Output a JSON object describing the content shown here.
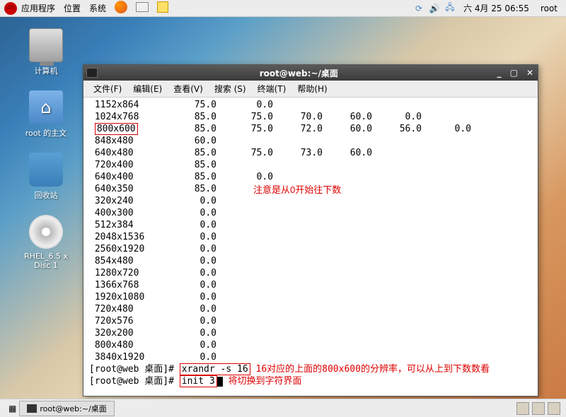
{
  "panel": {
    "apps": "应用程序",
    "places": "位置",
    "system": "系统",
    "clock": "六 4月 25 06:55",
    "user": "root"
  },
  "desktop": {
    "computer": "计算机",
    "home": "root 的主文",
    "trash": "回收站",
    "disc": "RHEL_6.5 x\nDisc 1"
  },
  "window": {
    "title": "root@web:~/桌面",
    "menu": {
      "file": "文件(F)",
      "edit": "编辑(E)",
      "view": "查看(V)",
      "search": "搜索 (S)",
      "terminal": "终端(T)",
      "help": "帮助(H)"
    }
  },
  "xrandr_rows": [
    {
      "res": "1152x864",
      "cols": [
        "75.0",
        "0.0",
        "",
        "",
        "",
        ""
      ]
    },
    {
      "res": "1024x768",
      "cols": [
        "85.0",
        "75.0",
        "70.0",
        "60.0",
        "0.0",
        ""
      ]
    },
    {
      "res": "800x600",
      "cols": [
        "85.0",
        "75.0",
        "72.0",
        "60.0",
        "56.0",
        "0.0"
      ],
      "box": true
    },
    {
      "res": "848x480",
      "cols": [
        "60.0",
        "",
        "",
        "",
        "",
        ""
      ]
    },
    {
      "res": "640x480",
      "cols": [
        "85.0",
        "75.0",
        "73.0",
        "60.0",
        "",
        ""
      ]
    },
    {
      "res": "720x400",
      "cols": [
        "85.0",
        "",
        "",
        "",
        "",
        ""
      ]
    },
    {
      "res": "640x400",
      "cols": [
        "85.0",
        "0.0",
        "",
        "",
        "",
        ""
      ]
    },
    {
      "res": "640x350",
      "cols": [
        "85.0",
        "",
        "",
        "",
        "",
        ""
      ]
    },
    {
      "res": "320x240",
      "cols": [
        "0.0",
        "",
        "",
        "",
        "",
        ""
      ]
    },
    {
      "res": "400x300",
      "cols": [
        "0.0",
        "",
        "",
        "",
        "",
        ""
      ]
    },
    {
      "res": "512x384",
      "cols": [
        "0.0",
        "",
        "",
        "",
        "",
        ""
      ]
    },
    {
      "res": "2048x1536",
      "cols": [
        "0.0",
        "",
        "",
        "",
        "",
        ""
      ]
    },
    {
      "res": "2560x1920",
      "cols": [
        "0.0",
        "",
        "",
        "",
        "",
        ""
      ]
    },
    {
      "res": "854x480",
      "cols": [
        "0.0",
        "",
        "",
        "",
        "",
        ""
      ]
    },
    {
      "res": "1280x720",
      "cols": [
        "0.0",
        "",
        "",
        "",
        "",
        ""
      ]
    },
    {
      "res": "1366x768",
      "cols": [
        "0.0",
        "",
        "",
        "",
        "",
        ""
      ]
    },
    {
      "res": "1920x1080",
      "cols": [
        "0.0",
        "",
        "",
        "",
        "",
        ""
      ]
    },
    {
      "res": "720x480",
      "cols": [
        "0.0",
        "",
        "",
        "",
        "",
        ""
      ]
    },
    {
      "res": "720x576",
      "cols": [
        "0.0",
        "",
        "",
        "",
        "",
        ""
      ]
    },
    {
      "res": "320x200",
      "cols": [
        "0.0",
        "",
        "",
        "",
        "",
        ""
      ]
    },
    {
      "res": "800x480",
      "cols": [
        "0.0",
        "",
        "",
        "",
        "",
        ""
      ]
    },
    {
      "res": "3840x1920",
      "cols": [
        "0.0",
        "",
        "",
        "",
        "",
        ""
      ]
    }
  ],
  "prompts": [
    {
      "prompt": "[root@web 桌面]#",
      "cmd": "xrandr -s 16",
      "note": "16对应的上面的800x600的分辨率，可以从上到下数数看"
    },
    {
      "prompt": "[root@web 桌面]#",
      "cmd": "init 3",
      "note": "将切换到字符界面",
      "cursor": true
    }
  ],
  "annotations": {
    "count_note": "注意是从0开始往下数"
  },
  "taskbar": {
    "task1": "root@web:~/桌面"
  }
}
